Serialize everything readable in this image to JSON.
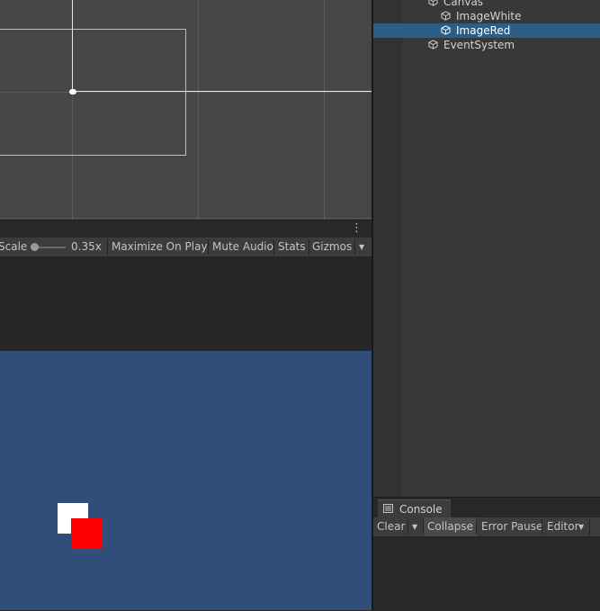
{
  "game_toolbar": {
    "scale_label": "Scale",
    "scale_value": "0.35x",
    "maximize_on_play": "Maximize On Play",
    "mute_audio": "Mute Audio",
    "stats": "Stats",
    "gizmos": "Gizmos",
    "dropdown_arrow": "▼",
    "more_menu": "⋮"
  },
  "hierarchy": {
    "items": [
      {
        "label": "Canvas",
        "icon": "gameobject-cube-icon",
        "expanded": true
      },
      {
        "label": "ImageWhite",
        "icon": "gameobject-cube-icon"
      },
      {
        "label": "ImageRed",
        "icon": "gameobject-cube-icon",
        "selected": true
      },
      {
        "label": "EventSystem",
        "icon": "gameobject-cube-icon"
      }
    ]
  },
  "console": {
    "tab_label": "Console",
    "clear": "Clear",
    "clear_dropdown": "▼",
    "collapse": "Collapse",
    "error_pause": "Error Pause",
    "editor": "Editor",
    "editor_dropdown": "▼"
  },
  "colors": {
    "game_background": "#314d79",
    "selection": "#2c5d87",
    "image_white": "#ffffff",
    "image_red": "#ff0000"
  }
}
